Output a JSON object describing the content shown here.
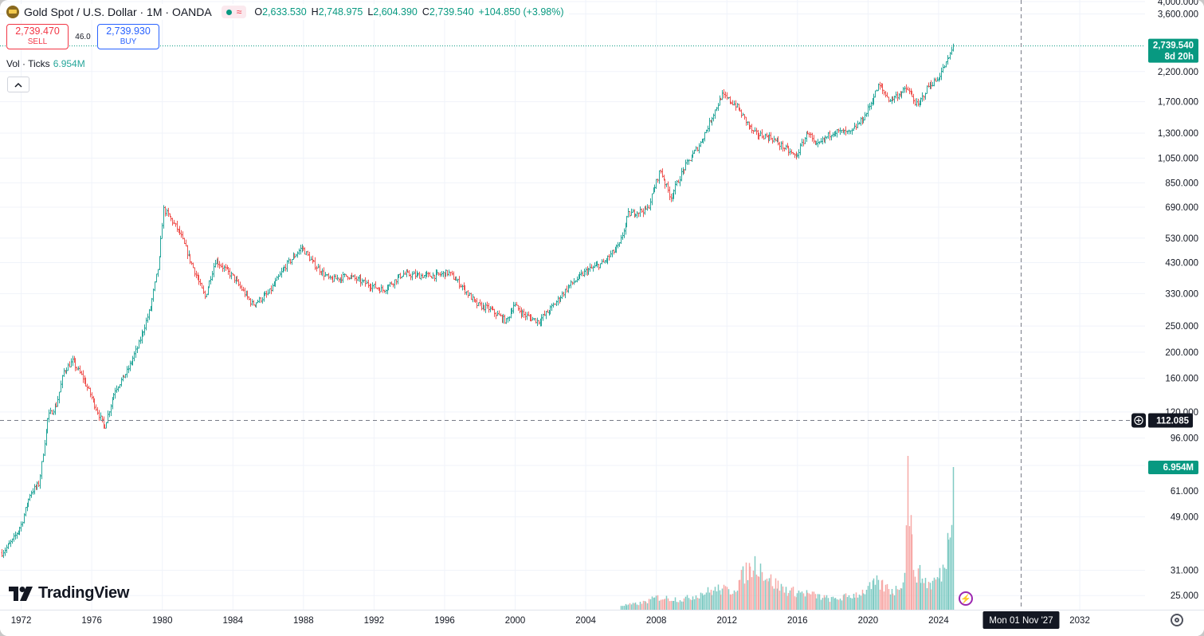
{
  "header": {
    "symbol_title": "Gold Spot / U.S. Dollar · 1M · OANDA",
    "status_wave": "≈",
    "ohlc": {
      "o_label": "O",
      "o": "2,633.530",
      "h_label": "H",
      "h": "2,748.975",
      "l_label": "L",
      "l": "2,604.390",
      "c_label": "C",
      "c": "2,739.540",
      "change": "+104.850 (+3.98%)"
    }
  },
  "trade": {
    "sell_price": "2,739.470",
    "sell_label": "SELL",
    "spread": "46.0",
    "buy_price": "2,739.930",
    "buy_label": "BUY"
  },
  "volume_legend": {
    "label": "Vol · Ticks",
    "value": "6.954M"
  },
  "brand": "TradingView",
  "last_price_label": {
    "price": "2,739.540",
    "countdown": "8d 20h"
  },
  "volume_label": "6.954M",
  "crosshair": {
    "price": "112.085",
    "date": "Mon 01 Nov '27"
  },
  "colors": {
    "up": "#26a69a",
    "down": "#ef5350",
    "vol_up": "#80cbc4",
    "vol_down": "#f7a9a7",
    "last_price": "#089981",
    "crosshair_tag": "#131722"
  },
  "chart_data": {
    "type": "candlestick",
    "title": "Gold Spot / U.S. Dollar",
    "interval": "1M",
    "source": "OANDA",
    "y_scale": "log",
    "ylim": [
      22,
      4000
    ],
    "y_ticks": [
      "4,000.000",
      "3,600.000",
      "2,200.000",
      "1,700.000",
      "1,300.000",
      "1,050.000",
      "850.000",
      "690.000",
      "530.000",
      "430.000",
      "330.000",
      "250.000",
      "200.000",
      "160.000",
      "120.000",
      "96.000",
      "76.000",
      "61.000",
      "49.000",
      "31.000",
      "25.000"
    ],
    "x_ticks": [
      "1972",
      "1976",
      "1980",
      "1984",
      "1988",
      "1992",
      "1996",
      "2000",
      "2004",
      "2008",
      "2012",
      "2016",
      "2020",
      "2024",
      "2032"
    ],
    "xlim": [
      1970.8,
      2035.7
    ],
    "grid": true,
    "price_path": [
      [
        1970.9,
        36
      ],
      [
        1971.5,
        40
      ],
      [
        1972.0,
        46
      ],
      [
        1972.5,
        60
      ],
      [
        1973.0,
        65
      ],
      [
        1973.5,
        115
      ],
      [
        1974.0,
        128
      ],
      [
        1974.4,
        170
      ],
      [
        1974.9,
        185
      ],
      [
        1975.5,
        160
      ],
      [
        1976.0,
        135
      ],
      [
        1976.7,
        105
      ],
      [
        1977.3,
        145
      ],
      [
        1978.0,
        170
      ],
      [
        1978.6,
        210
      ],
      [
        1979.3,
        290
      ],
      [
        1979.8,
        430
      ],
      [
        1980.05,
        680
      ],
      [
        1980.5,
        620
      ],
      [
        1981.0,
        550
      ],
      [
        1981.5,
        450
      ],
      [
        1982.4,
        320
      ],
      [
        1983.0,
        440
      ],
      [
        1984.0,
        380
      ],
      [
        1985.1,
        300
      ],
      [
        1986.0,
        330
      ],
      [
        1987.0,
        420
      ],
      [
        1987.9,
        490
      ],
      [
        1988.5,
        430
      ],
      [
        1989.5,
        370
      ],
      [
        1990.5,
        385
      ],
      [
        1991.5,
        360
      ],
      [
        1992.5,
        340
      ],
      [
        1993.6,
        390
      ],
      [
        1994.5,
        385
      ],
      [
        1995.5,
        385
      ],
      [
        1996.2,
        395
      ],
      [
        1997.0,
        350
      ],
      [
        1997.8,
        300
      ],
      [
        1998.5,
        290
      ],
      [
        1999.5,
        260
      ],
      [
        1999.9,
        300
      ],
      [
        2000.5,
        275
      ],
      [
        2001.3,
        260
      ],
      [
        2002.0,
        290
      ],
      [
        2003.0,
        350
      ],
      [
        2004.0,
        400
      ],
      [
        2005.0,
        430
      ],
      [
        2005.9,
        500
      ],
      [
        2006.4,
        650
      ],
      [
        2007.5,
        680
      ],
      [
        2008.2,
        950
      ],
      [
        2008.8,
        750
      ],
      [
        2009.5,
        950
      ],
      [
        2010.5,
        1200
      ],
      [
        2011.7,
        1800
      ],
      [
        2012.5,
        1650
      ],
      [
        2013.5,
        1300
      ],
      [
        2014.5,
        1250
      ],
      [
        2015.9,
        1060
      ],
      [
        2016.6,
        1330
      ],
      [
        2017.0,
        1150
      ],
      [
        2018.0,
        1320
      ],
      [
        2019.0,
        1300
      ],
      [
        2019.8,
        1500
      ],
      [
        2020.6,
        1960
      ],
      [
        2021.2,
        1720
      ],
      [
        2022.2,
        1900
      ],
      [
        2022.8,
        1630
      ],
      [
        2023.4,
        1950
      ],
      [
        2023.9,
        2050
      ],
      [
        2024.6,
        2500
      ],
      [
        2024.85,
        2739.54
      ]
    ],
    "volume_path": [
      [
        2005.9,
        0.2
      ],
      [
        2007.0,
        0.3
      ],
      [
        2008.0,
        0.6
      ],
      [
        2009.5,
        0.5
      ],
      [
        2010.5,
        0.8
      ],
      [
        2011.5,
        1.0
      ],
      [
        2012.2,
        0.9
      ],
      [
        2013.0,
        1.8
      ],
      [
        2013.7,
        2.3
      ],
      [
        2014.5,
        1.4
      ],
      [
        2015.5,
        0.9
      ],
      [
        2016.5,
        0.8
      ],
      [
        2018.0,
        0.5
      ],
      [
        2019.5,
        0.8
      ],
      [
        2020.5,
        1.3
      ],
      [
        2021.5,
        0.9
      ],
      [
        2022.1,
        1.8
      ],
      [
        2022.2,
        7.5
      ],
      [
        2022.4,
        3.9
      ],
      [
        2022.6,
        2.0
      ],
      [
        2023.5,
        1.2
      ],
      [
        2024.2,
        1.8
      ],
      [
        2024.85,
        6.954
      ]
    ]
  }
}
